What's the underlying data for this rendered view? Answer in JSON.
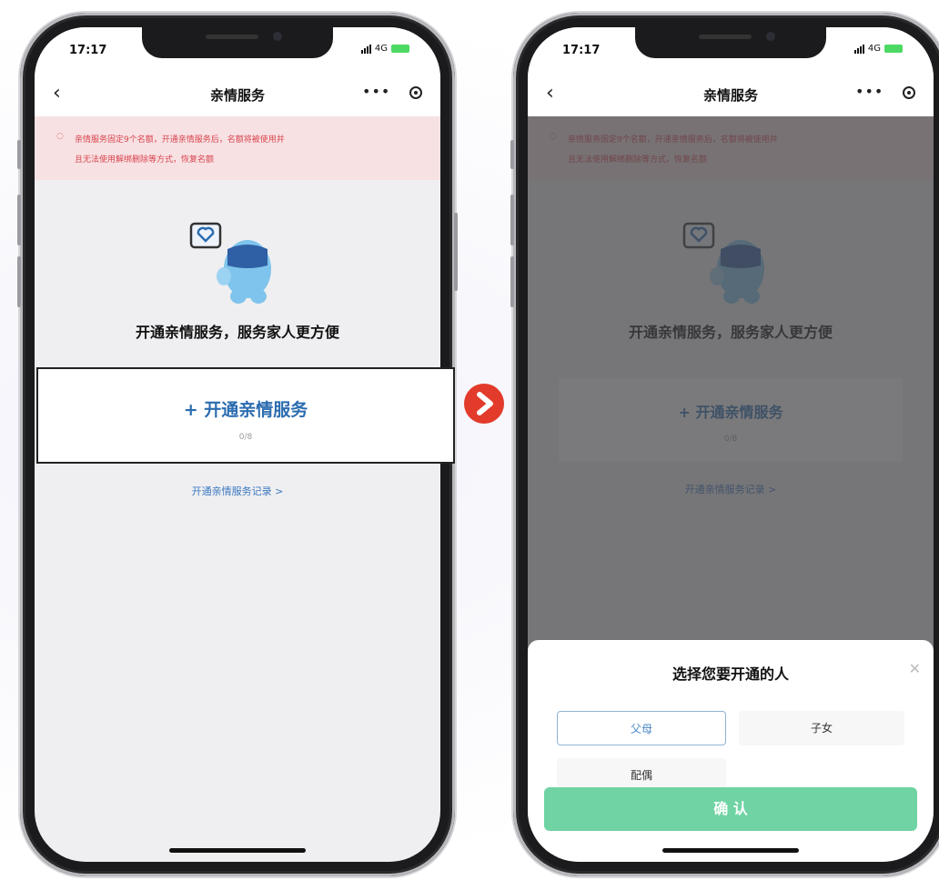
{
  "status": {
    "time": "17:17",
    "network": "4G"
  },
  "nav": {
    "title": "亲情服务"
  },
  "notice": {
    "line1": "亲情服务固定9个名额，开通亲情服务后，名额将被使用并",
    "line2": "且无法使用解绑删除等方式，恢复名额"
  },
  "main": {
    "heading": "开通亲情服务，服务家人更方便",
    "open_button": "开通亲情服务",
    "count": "0/8",
    "record_link": "开通亲情服务记录"
  },
  "sheet": {
    "title": "选择您要开通的人",
    "options": [
      "父母",
      "子女",
      "配偶"
    ],
    "selected": "父母",
    "confirm": "确 认"
  },
  "colors": {
    "accent": "#2b6cb0",
    "confirm": "#6fd3a3",
    "notice": "#d9454f",
    "arrow": "#e23b2b"
  },
  "icons": [
    "back-icon",
    "more-icon",
    "target-icon",
    "plus-icon",
    "close-icon",
    "chevron-right-icon",
    "mascot-illustration",
    "arrow-right-icon"
  ]
}
